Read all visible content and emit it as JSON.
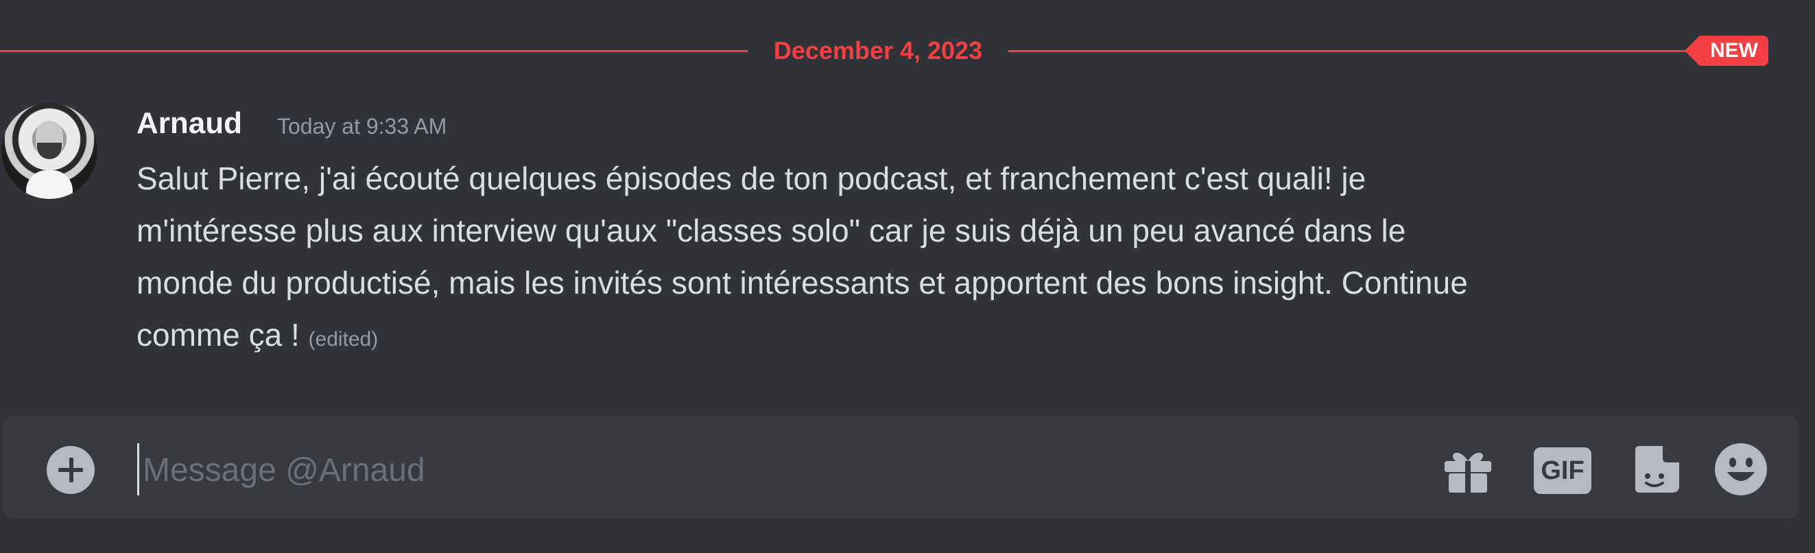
{
  "divider": {
    "date": "December 4, 2023",
    "new_badge": "NEW"
  },
  "message": {
    "author": "Arnaud",
    "timestamp": "Today at 9:33 AM",
    "lines": [
      "Salut Pierre, j'ai écouté quelques épisodes de ton podcast, et franchement c'est quali! je",
      "m'intéresse plus aux interview qu'aux \"classes solo\" car je suis déjà un peu avancé dans le",
      "monde du productisé, mais les invités sont intéressants et apportent des bons insight. Continue",
      "comme ça !"
    ],
    "edited_label": "(edited)"
  },
  "composer": {
    "placeholder": "Message @Arnaud",
    "gif_label": "GIF",
    "icons": [
      "add-icon",
      "gift-icon",
      "gif-icon",
      "sticker-icon",
      "emoji-icon"
    ]
  },
  "colors": {
    "background": "#313338",
    "composer": "#383a40",
    "accent_red": "#f23f43",
    "icon": "#b5bac1",
    "muted_text": "#949ba4"
  }
}
